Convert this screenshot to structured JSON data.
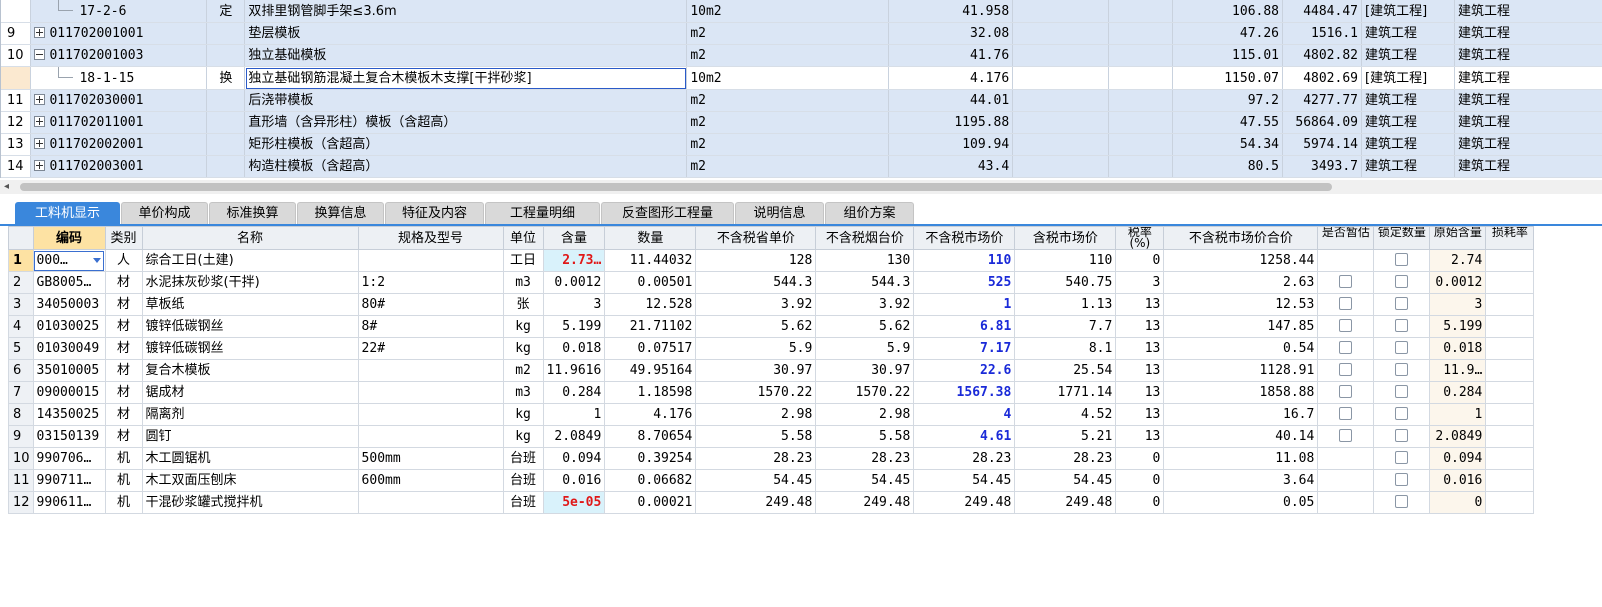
{
  "top_rows": [
    {
      "no": "",
      "code": "17-2-6",
      "kind": "sub",
      "type": "定",
      "name": "双排里钢管脚手架≤3.6m",
      "unit": "10m2",
      "qty": "41.958",
      "price": "106.88",
      "total": "4484.47",
      "major": "[建筑工程]",
      "spec": "建筑工程",
      "expander": "",
      "cls": "hl"
    },
    {
      "no": "9",
      "code": "011702001001",
      "kind": "item",
      "type": "",
      "name": "垫层模板",
      "unit": "m2",
      "qty": "32.08",
      "price": "47.26",
      "total": "1516.1",
      "major": "建筑工程",
      "spec": "建筑工程",
      "expander": "plus",
      "cls": "hl"
    },
    {
      "no": "10",
      "code": "011702001003",
      "kind": "item",
      "type": "",
      "name": "独立基础模板",
      "unit": "m2",
      "qty": "41.76",
      "price": "115.01",
      "total": "4802.82",
      "major": "建筑工程",
      "spec": "建筑工程",
      "expander": "minus",
      "cls": "hl"
    },
    {
      "no": "",
      "code": "18-1-15",
      "kind": "sub",
      "type": "换",
      "name": "独立基础钢筋混凝土复合木模板木支撑[干拌砂浆]",
      "unit": "10m2",
      "qty": "4.176",
      "price": "1150.07",
      "total": "4802.69",
      "major": "[建筑工程]",
      "spec": "建筑工程",
      "expander": "",
      "cls": "sub"
    },
    {
      "no": "11",
      "code": "011702030001",
      "kind": "item",
      "type": "",
      "name": "后浇带模板",
      "unit": "m2",
      "qty": "44.01",
      "price": "97.2",
      "total": "4277.77",
      "major": "建筑工程",
      "spec": "建筑工程",
      "expander": "plus",
      "cls": "hl"
    },
    {
      "no": "12",
      "code": "011702011001",
      "kind": "item",
      "type": "",
      "name": "直形墙（含异形柱）模板（含超高）",
      "unit": "m2",
      "qty": "1195.88",
      "price": "47.55",
      "total": "56864.09",
      "major": "建筑工程",
      "spec": "建筑工程",
      "expander": "plus",
      "cls": "hl"
    },
    {
      "no": "13",
      "code": "011702002001",
      "kind": "item",
      "type": "",
      "name": "矩形柱模板（含超高）",
      "unit": "m2",
      "qty": "109.94",
      "price": "54.34",
      "total": "5974.14",
      "major": "建筑工程",
      "spec": "建筑工程",
      "expander": "plus",
      "cls": "hl"
    },
    {
      "no": "14",
      "code": "011702003001",
      "kind": "item",
      "type": "",
      "name": "构造柱模板（含超高）",
      "unit": "m2",
      "qty": "43.4",
      "price": "80.5",
      "total": "3493.7",
      "major": "建筑工程",
      "spec": "建筑工程",
      "expander": "plus",
      "cls": "hl"
    }
  ],
  "tabs": [
    {
      "label": "工料机显示",
      "active": true
    },
    {
      "label": "单价构成",
      "active": false
    },
    {
      "label": "标准换算",
      "active": false
    },
    {
      "label": "换算信息",
      "active": false
    },
    {
      "label": "特征及内容",
      "active": false
    },
    {
      "label": "工程量明细",
      "active": false
    },
    {
      "label": "反查图形工程量",
      "active": false
    },
    {
      "label": "说明信息",
      "active": false
    },
    {
      "label": "组价方案",
      "active": false
    }
  ],
  "columns": [
    "编码",
    "类别",
    "名称",
    "规格及型号",
    "单位",
    "含量",
    "数量",
    "不含税省单价",
    "不含税烟台价",
    "不含税市场价",
    "含税市场价",
    "税率(%)",
    "不含税市场价合价",
    "是否暂估",
    "锁定数量",
    "原始含量",
    "损耗率"
  ],
  "rows": [
    {
      "no": "1",
      "code": "000…",
      "cat": "人",
      "name": "综合工日(土建)",
      "spec": "",
      "unit": "工日",
      "content": "2.73…",
      "qty": "11.44032",
      "prov": "128",
      "yt": "130",
      "mkt": "110",
      "mkt_tax": "110",
      "tax": "0",
      "total": "1258.44",
      "est": false,
      "lock": true,
      "orig": "2.74",
      "content_red": true,
      "mkt_blue": true
    },
    {
      "no": "2",
      "code": "GB8005…",
      "cat": "材",
      "name": "水泥抹灰砂浆(干拌)",
      "spec": "1:2",
      "unit": "m3",
      "content": "0.0012",
      "qty": "0.00501",
      "prov": "544.3",
      "yt": "544.3",
      "mkt": "525",
      "mkt_tax": "540.75",
      "tax": "3",
      "total": "2.63",
      "est": true,
      "lock": true,
      "orig": "0.0012",
      "content_red": false,
      "mkt_blue": true
    },
    {
      "no": "3",
      "code": "34050003",
      "cat": "材",
      "name": "草板纸",
      "spec": "80#",
      "unit": "张",
      "content": "3",
      "qty": "12.528",
      "prov": "3.92",
      "yt": "3.92",
      "mkt": "1",
      "mkt_tax": "1.13",
      "tax": "13",
      "total": "12.53",
      "est": true,
      "lock": true,
      "orig": "3",
      "content_red": false,
      "mkt_blue": true
    },
    {
      "no": "4",
      "code": "01030025",
      "cat": "材",
      "name": "镀锌低碳钢丝",
      "spec": "8#",
      "unit": "kg",
      "content": "5.199",
      "qty": "21.71102",
      "prov": "5.62",
      "yt": "5.62",
      "mkt": "6.81",
      "mkt_tax": "7.7",
      "tax": "13",
      "total": "147.85",
      "est": true,
      "lock": true,
      "orig": "5.199",
      "content_red": false,
      "mkt_blue": true
    },
    {
      "no": "5",
      "code": "01030049",
      "cat": "材",
      "name": "镀锌低碳钢丝",
      "spec": "22#",
      "unit": "kg",
      "content": "0.018",
      "qty": "0.07517",
      "prov": "5.9",
      "yt": "5.9",
      "mkt": "7.17",
      "mkt_tax": "8.1",
      "tax": "13",
      "total": "0.54",
      "est": true,
      "lock": true,
      "orig": "0.018",
      "content_red": false,
      "mkt_blue": true
    },
    {
      "no": "6",
      "code": "35010005",
      "cat": "材",
      "name": "复合木模板",
      "spec": "",
      "unit": "m2",
      "content": "11.9616",
      "qty": "49.95164",
      "prov": "30.97",
      "yt": "30.97",
      "mkt": "22.6",
      "mkt_tax": "25.54",
      "tax": "13",
      "total": "1128.91",
      "est": true,
      "lock": true,
      "orig": "11.9…",
      "content_red": false,
      "mkt_blue": true
    },
    {
      "no": "7",
      "code": "09000015",
      "cat": "材",
      "name": "锯成材",
      "spec": "",
      "unit": "m3",
      "content": "0.284",
      "qty": "1.18598",
      "prov": "1570.22",
      "yt": "1570.22",
      "mkt": "1567.38",
      "mkt_tax": "1771.14",
      "tax": "13",
      "total": "1858.88",
      "est": true,
      "lock": true,
      "orig": "0.284",
      "content_red": false,
      "mkt_blue": true
    },
    {
      "no": "8",
      "code": "14350025",
      "cat": "材",
      "name": "隔离剂",
      "spec": "",
      "unit": "kg",
      "content": "1",
      "qty": "4.176",
      "prov": "2.98",
      "yt": "2.98",
      "mkt": "4",
      "mkt_tax": "4.52",
      "tax": "13",
      "total": "16.7",
      "est": true,
      "lock": true,
      "orig": "1",
      "content_red": false,
      "mkt_blue": true
    },
    {
      "no": "9",
      "code": "03150139",
      "cat": "材",
      "name": "圆钉",
      "spec": "",
      "unit": "kg",
      "content": "2.0849",
      "qty": "8.70654",
      "prov": "5.58",
      "yt": "5.58",
      "mkt": "4.61",
      "mkt_tax": "5.21",
      "tax": "13",
      "total": "40.14",
      "est": true,
      "lock": true,
      "orig": "2.0849",
      "content_red": false,
      "mkt_blue": true
    },
    {
      "no": "10",
      "code": "990706…",
      "cat": "机",
      "name": "木工圆锯机",
      "spec": "500mm",
      "unit": "台班",
      "content": "0.094",
      "qty": "0.39254",
      "prov": "28.23",
      "yt": "28.23",
      "mkt": "28.23",
      "mkt_tax": "28.23",
      "tax": "0",
      "total": "11.08",
      "est": false,
      "lock": true,
      "orig": "0.094",
      "content_red": false,
      "mkt_blue": false
    },
    {
      "no": "11",
      "code": "990711…",
      "cat": "机",
      "name": "木工双面压刨床",
      "spec": "600mm",
      "unit": "台班",
      "content": "0.016",
      "qty": "0.06682",
      "prov": "54.45",
      "yt": "54.45",
      "mkt": "54.45",
      "mkt_tax": "54.45",
      "tax": "0",
      "total": "3.64",
      "est": false,
      "lock": true,
      "orig": "0.016",
      "content_red": false,
      "mkt_blue": false
    },
    {
      "no": "12",
      "code": "990611…",
      "cat": "机",
      "name": "干混砂浆罐式搅拌机",
      "spec": "",
      "unit": "台班",
      "content": "5e-05",
      "qty": "0.00021",
      "prov": "249.48",
      "yt": "249.48",
      "mkt": "249.48",
      "mkt_tax": "249.48",
      "tax": "0",
      "total": "0.05",
      "est": false,
      "lock": true,
      "orig": "0",
      "content_red": true,
      "mkt_blue": false
    }
  ],
  "colors": {
    "accent": "#3a87dc",
    "row_highlight": "#dbe6f5",
    "market_price": "#1a2ad8",
    "content_red": "#e01818"
  },
  "icons": {
    "scroll_left": "scroll-left-arrow-icon",
    "dropdown": "dropdown-arrow-icon",
    "expand": "expand-plus-icon",
    "collapse": "collapse-minus-icon",
    "checkbox": "checkbox-icon"
  }
}
